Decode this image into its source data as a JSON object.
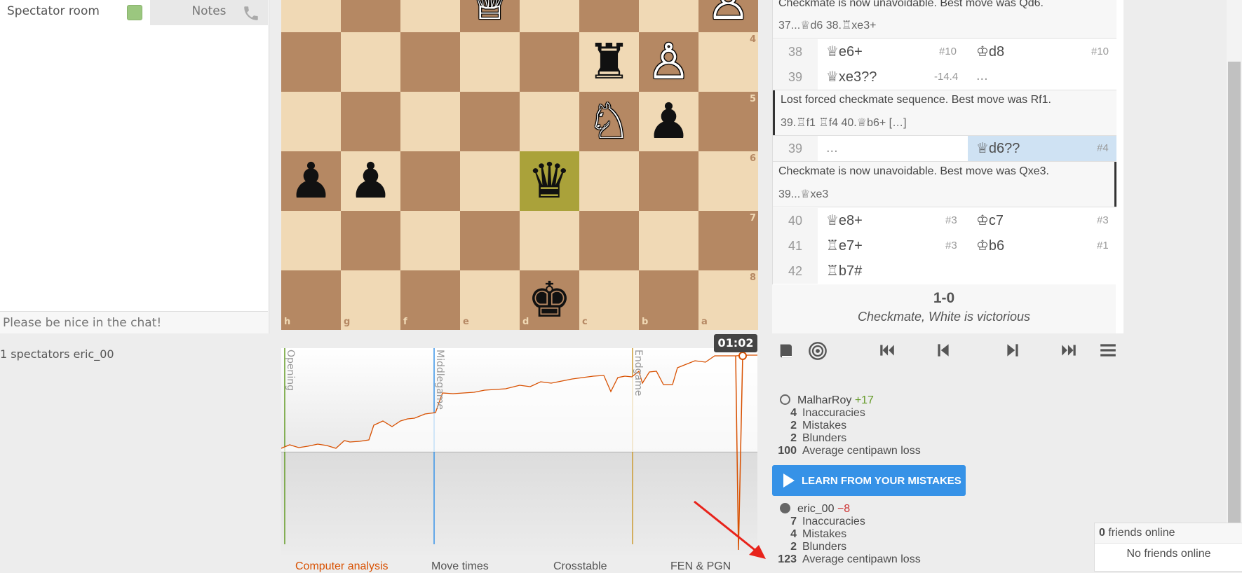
{
  "chat": {
    "tab_spectator": "Spectator room",
    "tab_notes": "Notes",
    "input_placeholder": "Please be nice in the chat!",
    "spectators": "1 spectators eric_00"
  },
  "board": {
    "files": [
      "h",
      "g",
      "f",
      "e",
      "d",
      "c",
      "b",
      "a"
    ],
    "ranks": [
      "4",
      "5",
      "6",
      "7",
      "8"
    ],
    "highlight_square": "d6",
    "pieces": [
      {
        "sq": "e3",
        "glyph": "♕",
        "color": "white"
      },
      {
        "sq": "a3",
        "glyph": "♙",
        "color": "white"
      },
      {
        "sq": "c4",
        "glyph": "♜",
        "color": "black"
      },
      {
        "sq": "b4",
        "glyph": "♙",
        "color": "white"
      },
      {
        "sq": "c5",
        "glyph": "♘",
        "color": "white"
      },
      {
        "sq": "b5",
        "glyph": "♟",
        "color": "black"
      },
      {
        "sq": "h6",
        "glyph": "♟",
        "color": "black"
      },
      {
        "sq": "g6",
        "glyph": "♟",
        "color": "black"
      },
      {
        "sq": "d6",
        "glyph": "♛",
        "color": "black"
      },
      {
        "sq": "d8",
        "glyph": "♚",
        "color": "black"
      }
    ]
  },
  "moves": {
    "comment1": "Checkmate is now unavoidable. Best move was Qd6.",
    "line1": "37...♕d6 38.♖xe3+",
    "rows": [
      {
        "num": "38",
        "white": "♕e6+",
        "white_eval": "#10",
        "black": "♔d8",
        "black_eval": "#10"
      },
      {
        "num": "39",
        "white": "♕xe3??",
        "white_eval": "-14.4",
        "black": "...",
        "black_eval": ""
      }
    ],
    "comment2": "Lost forced checkmate sequence. Best move was Rf1.",
    "line2": "39.♖f1 ♖f4 40.♕b6+ […]",
    "active_row": {
      "num": "39",
      "white": "...",
      "black": "♕d6??",
      "black_eval": "#4"
    },
    "comment3": "Checkmate is now unavoidable. Best move was Qxe3.",
    "line3": "39...♕xe3",
    "rows2": [
      {
        "num": "40",
        "white": "♕e8+",
        "white_eval": "#3",
        "black": "♔c7",
        "black_eval": "#3"
      },
      {
        "num": "41",
        "white": "♖e7+",
        "white_eval": "#3",
        "black": "♔b6",
        "black_eval": "#1"
      },
      {
        "num": "42",
        "white": "♖b7#",
        "white_eval": "",
        "black": "",
        "black_eval": ""
      }
    ],
    "result": "1-0",
    "result_text": "Checkmate, White is victorious"
  },
  "chart": {
    "clock": "01:02",
    "phases": [
      "Opening",
      "Middlegame",
      "Endgame"
    ],
    "colors": {
      "line": "#d85000",
      "opening": "#639b24",
      "middlegame": "#3893e8",
      "endgame": "#cc9b33"
    }
  },
  "toolbar": [
    "book-icon",
    "target-icon",
    "first-icon",
    "prev-icon",
    "next-icon",
    "last-icon",
    "menu-icon"
  ],
  "white_player": {
    "name": "MalharRoy",
    "rating_diff": "+17",
    "stats": [
      {
        "n": "4",
        "label": "Inaccuracies"
      },
      {
        "n": "2",
        "label": "Mistakes"
      },
      {
        "n": "2",
        "label": "Blunders"
      },
      {
        "n": "100",
        "label": "Average centipawn loss"
      }
    ]
  },
  "learn_button": "LEARN FROM YOUR MISTAKES",
  "black_player": {
    "name": "eric_00",
    "rating_diff": "−8",
    "stats": [
      {
        "n": "7",
        "label": "Inaccuracies"
      },
      {
        "n": "4",
        "label": "Mistakes"
      },
      {
        "n": "2",
        "label": "Blunders"
      },
      {
        "n": "123",
        "label": "Average centipawn loss"
      }
    ]
  },
  "friends": {
    "count": "0",
    "label": "friends online",
    "empty": "No friends online"
  },
  "bottom_tabs": [
    "Computer analysis",
    "Move times",
    "Crosstable",
    "FEN & PGN"
  ]
}
